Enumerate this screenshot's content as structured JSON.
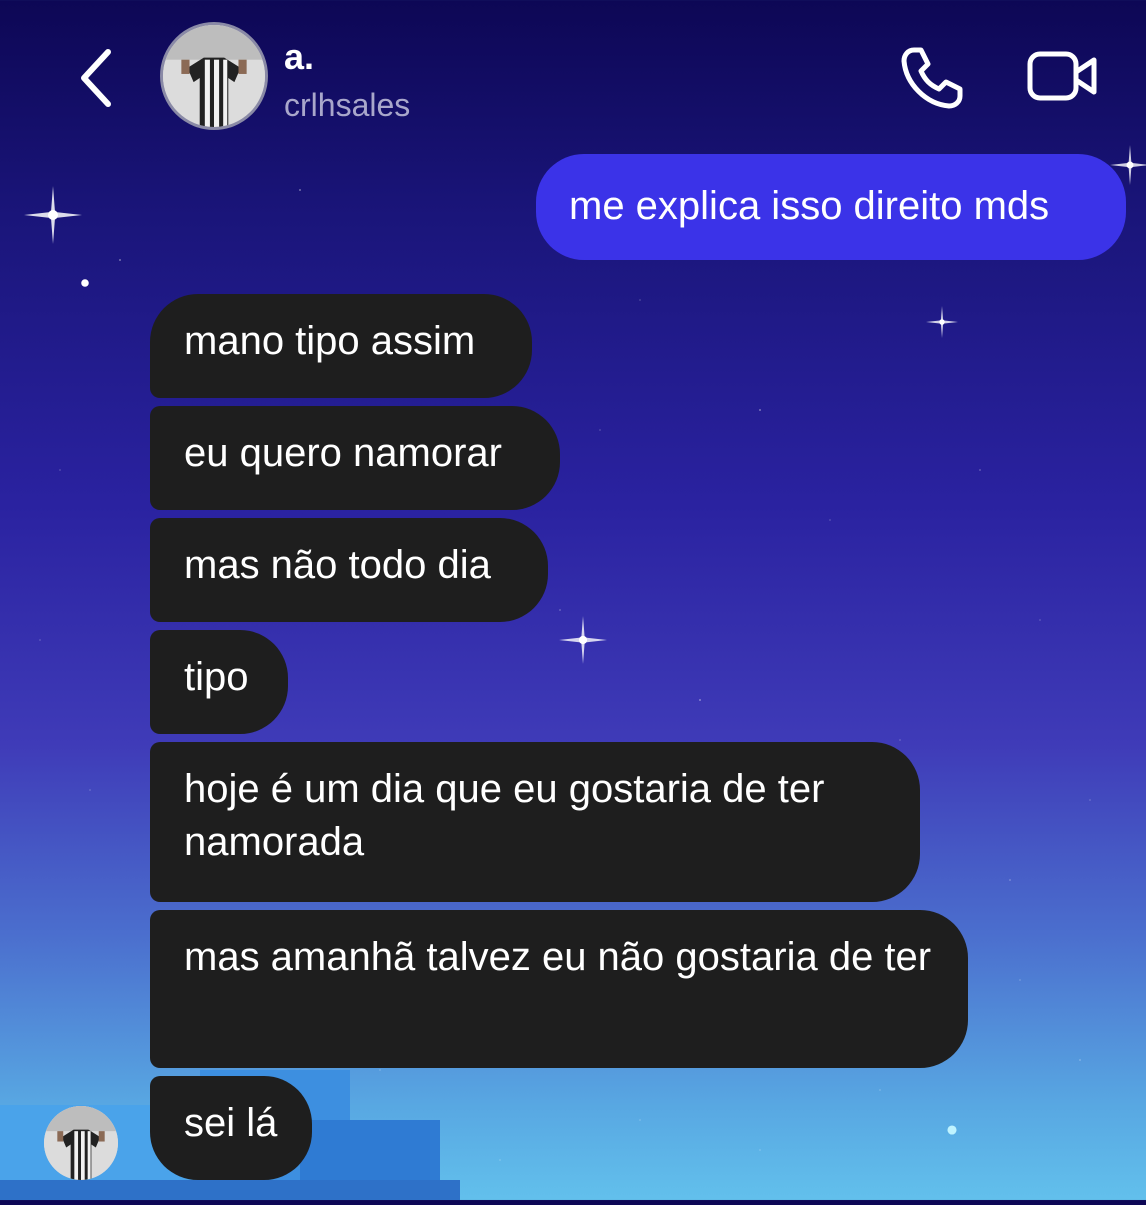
{
  "header": {
    "back_icon": "chevron-left-icon",
    "contact_name": "a.",
    "contact_username": "crlhsales",
    "call_icon": "phone-icon",
    "video_icon": "video-camera-icon"
  },
  "theme": {
    "sent_bubble_color": "#3b33e8",
    "received_bubble_color": "#1e1e1e",
    "text_color": "#ffffff",
    "username_color": "#a9a7cb"
  },
  "messages": {
    "sent": [
      {
        "text": "me explica isso direito mds"
      }
    ],
    "received": [
      {
        "text": "mano tipo assim"
      },
      {
        "text": "eu quero namorar"
      },
      {
        "text": "mas não todo dia"
      },
      {
        "text": "tipo"
      },
      {
        "text": "hoje é um dia que eu gostaria de ter namorada"
      },
      {
        "text": "mas amanhã talvez eu não gostaria de ter"
      },
      {
        "text": "sei lá"
      }
    ]
  }
}
